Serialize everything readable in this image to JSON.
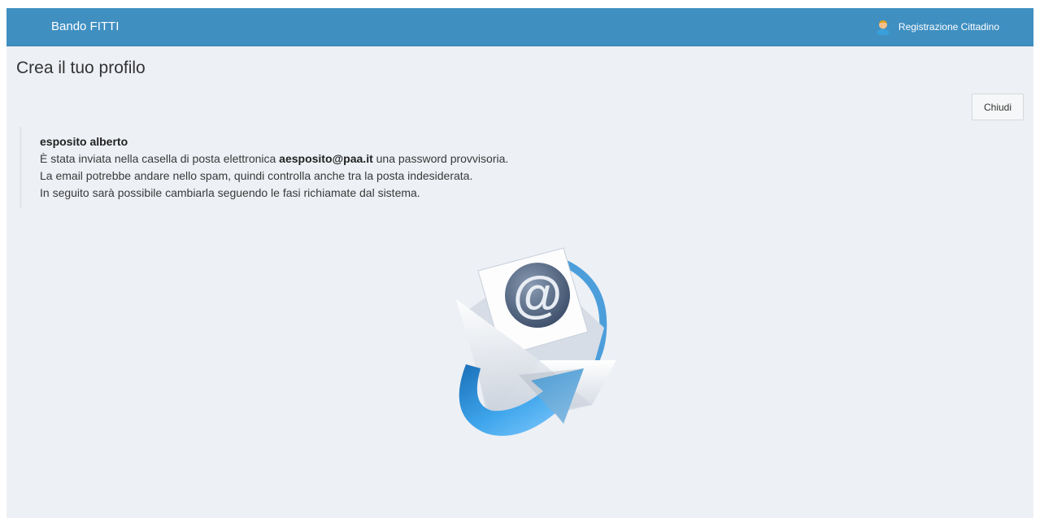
{
  "header": {
    "brand": "Bando FITTI",
    "user_menu_label": "Registrazione Cittadino",
    "user_icon": "user-avatar-icon"
  },
  "page": {
    "title": "Crea il tuo profilo",
    "close_button": "Chiudi"
  },
  "message": {
    "name": "esposito alberto",
    "line1_before": "È stata inviata nella casella di posta elettronica ",
    "email": "aesposito@paa.it",
    "line1_after": " una password provvisoria.",
    "line2": "La email potrebbe andare nello spam, quindi controlla anche tra la posta indesiderata.",
    "line3": "In seguito sarà possibile cambiarla seguendo le fasi richiamate dal sistema."
  },
  "illustration": {
    "icon": "email-sent-icon",
    "symbol": "@"
  },
  "colors": {
    "navbar": "#3f8fc1",
    "background": "#edf0f5",
    "arrow": "#2f8fd6"
  }
}
